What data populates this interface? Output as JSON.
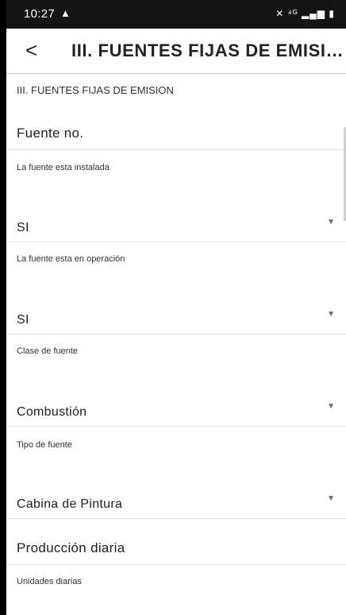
{
  "status_bar": {
    "time": "10:27",
    "alert_icon": "warning-icon",
    "right_icons": "mute, 4G data, signal, battery"
  },
  "app_bar": {
    "title": "III. FUENTES FIJAS DE EMISI…",
    "back_icon": "back-arrow-icon"
  },
  "form": {
    "section_caption": "III. FUENTES FIJAS DE EMISION",
    "source_heading": "Fuente no.",
    "installed": {
      "label": "La fuente esta instalada",
      "value": "SI"
    },
    "operating": {
      "label": "La fuente esta en operación",
      "value": "SI"
    },
    "source_class": {
      "label": "Clase de fuente",
      "value": "Combustión"
    },
    "source_type": {
      "label": "Tipo de fuente",
      "value": "Cabina de Pintura"
    },
    "production_heading": "Producción diaria",
    "daily_units": {
      "label": "Unidades diarias"
    }
  }
}
